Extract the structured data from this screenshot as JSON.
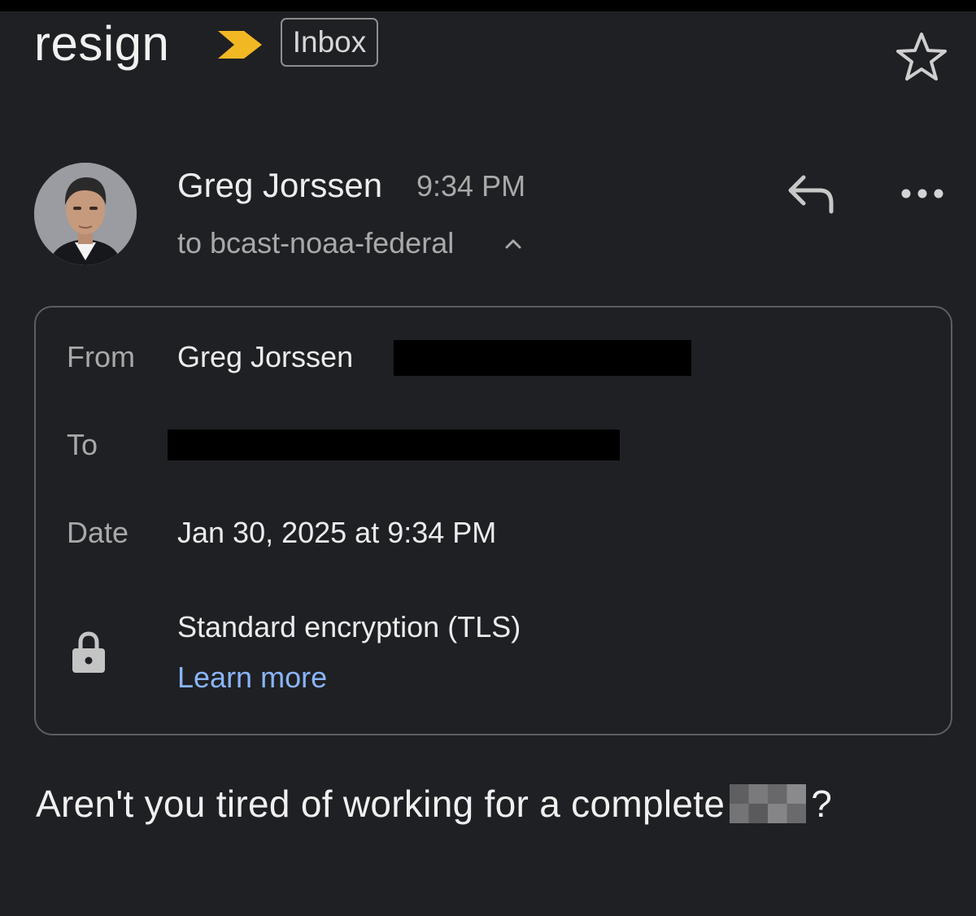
{
  "header": {
    "subject": "resign",
    "label_chip": "Inbox",
    "importance_icon": "importance-marker-icon",
    "star_icon": "star-icon",
    "colors": {
      "importance": "#f2b824",
      "background": "#1f2023"
    }
  },
  "message": {
    "sender_name": "Greg Jorssen",
    "time": "9:34 PM",
    "recipient_line": "to bcast-noaa-federal",
    "reply_icon": "reply-icon",
    "more_icon": "more-options-icon"
  },
  "details": {
    "from_label": "From",
    "from_value": "Greg Jorssen",
    "to_label": "To",
    "date_label": "Date",
    "date_value": "Jan 30, 2025 at 9:34 PM",
    "encryption": "Standard encryption (TLS)",
    "learn_more": "Learn more",
    "lock_icon": "lock-icon",
    "link_color": "#8ab4f8"
  },
  "body": {
    "text_before": "Aren't you tired of working for a complete",
    "text_after": "?"
  }
}
